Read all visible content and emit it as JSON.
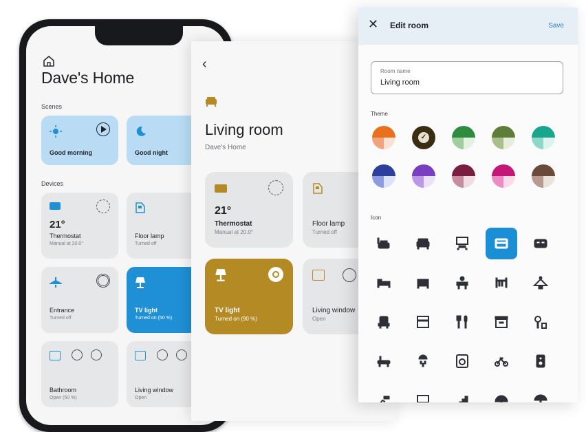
{
  "home": {
    "title": "Dave's Home",
    "scenes_label": "Scenes",
    "devices_label": "Devices",
    "scenes": [
      {
        "name": "Good morning"
      },
      {
        "name": "Good night"
      }
    ],
    "devices": [
      {
        "name": "Thermostat",
        "status": "Manual at 20.0°",
        "value": "21°"
      },
      {
        "name": "Floor lamp",
        "status": "Turned off"
      },
      {
        "name": "Entrance",
        "status": "Turned off"
      },
      {
        "name": "TV light",
        "status": "Turned on (50 %)"
      },
      {
        "name": "Bathroom",
        "status": "Open (50 %)"
      },
      {
        "name": "Living window",
        "status": "Open"
      }
    ]
  },
  "room": {
    "title": "Living room",
    "subtitle": "Dave's Home",
    "devices": [
      {
        "name": "Thermostat",
        "status": "Manual at 20.0°",
        "value": "21°"
      },
      {
        "name": "Floor lamp",
        "status": "Turned off"
      },
      {
        "name": "TV light",
        "status": "Turned on (90 %)"
      },
      {
        "name": "Living window",
        "status": "Open"
      }
    ]
  },
  "dialog": {
    "title": "Edit room",
    "save_label": "Save",
    "field_label": "Room name",
    "field_value": "Living room",
    "theme_label": "Theme",
    "icon_label": "Icon",
    "selected_theme_index": 1,
    "selected_icon_index": 3,
    "themes": [
      {
        "top": "#e8711f",
        "bl": "#f4a27a",
        "br": "#fbe1d3"
      },
      {
        "top": "#3b2c15",
        "bl": "#3b2c15",
        "br": "#3b2c15"
      },
      {
        "top": "#2e8b3f",
        "bl": "#9dcf9f",
        "br": "#e3f1e1"
      },
      {
        "top": "#5f7d3a",
        "bl": "#aac08b",
        "br": "#e6eedb"
      },
      {
        "top": "#1aa58d",
        "bl": "#8fd8c8",
        "br": "#ddf3ee"
      },
      {
        "top": "#2c3f9c",
        "bl": "#8d9be0",
        "br": "#dde2f8"
      },
      {
        "top": "#7a3fc1",
        "bl": "#bb98e6",
        "br": "#ece2f8"
      },
      {
        "top": "#7a1d3e",
        "bl": "#c88ca0",
        "br": "#f0dde3"
      },
      {
        "top": "#c2187a",
        "bl": "#ec8cc0",
        "br": "#f9dbea"
      },
      {
        "top": "#6b4a3c",
        "bl": "#b89b8e",
        "br": "#ece2dd"
      }
    ],
    "icons": [
      "sofa-lamp-icon",
      "sofa-icon",
      "desk-icon",
      "oven-icon",
      "double-sofa-icon",
      "bed-icon",
      "single-bed-icon",
      "desk-person-icon",
      "crib-icon",
      "hanger-icon",
      "armchair-icon",
      "cabinet-icon",
      "cutlery-icon",
      "drawer-icon",
      "broom-icon",
      "bathtub-icon",
      "shower-icon",
      "washing-machine-icon",
      "bike-icon",
      "speaker-icon",
      "chair-icon",
      "tv-icon",
      "stairs-icon",
      "tent-icon",
      "umbrella-icon"
    ]
  },
  "colors": {
    "accent": "#1b8fd6",
    "scene_tile": "#b9dcf4",
    "light_on_tile": "#1f8fd6",
    "room_light_on": "#b48a25",
    "dialog_header": "#e6eef6"
  }
}
